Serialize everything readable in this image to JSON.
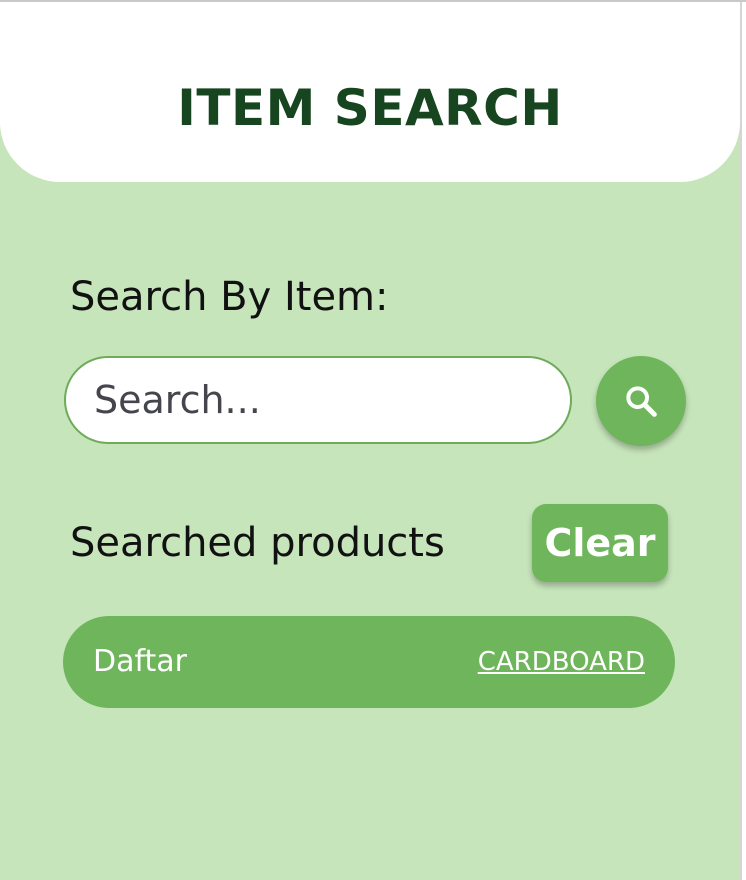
{
  "header": {
    "title": "ITEM SEARCH"
  },
  "search": {
    "label": "Search By Item:",
    "value": "",
    "placeholder": "Search...",
    "button_icon": "search-icon"
  },
  "results": {
    "label": "Searched products",
    "clear_label": "Clear",
    "items": [
      {
        "name": "Daftar",
        "category": "CARDBOARD"
      }
    ]
  },
  "colors": {
    "background": "#c6e5bb",
    "accent": "#6fb55b",
    "title": "#17451f"
  }
}
